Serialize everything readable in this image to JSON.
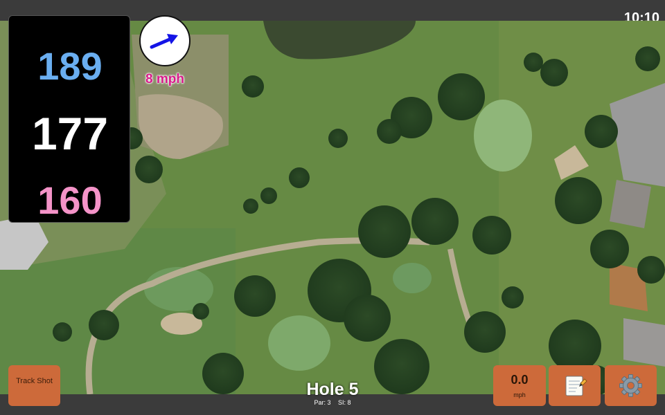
{
  "status": {
    "time": "10:10"
  },
  "yardage": {
    "back": "189",
    "center": "177",
    "front": "160"
  },
  "wind": {
    "speed": "8 mph",
    "icon": "wind-direction-arrow-icon"
  },
  "buttons": {
    "track_shot": "Track Shot",
    "speed_value": "0.0",
    "speed_unit": "mph",
    "notes_icon": "notepad-icon",
    "settings_icon": "gear-icon"
  },
  "hole": {
    "title": "Hole 5",
    "par": "Par: 3",
    "si": "SI: 8"
  },
  "colors": {
    "back": "#6aaef0",
    "center": "#ffffff",
    "front": "#f493c8",
    "wind_text": "#d81b8a",
    "button": "#cd6a3a"
  }
}
